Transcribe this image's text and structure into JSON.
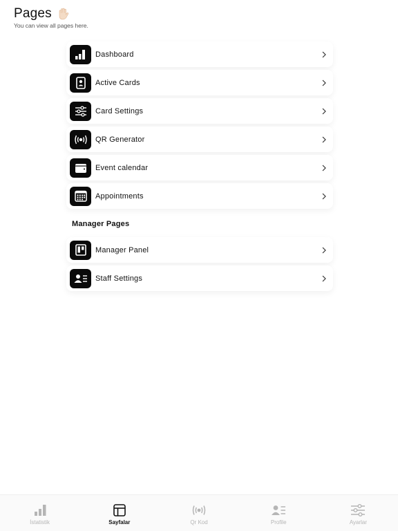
{
  "header": {
    "title": "Pages",
    "subtitle": "You can view all pages here."
  },
  "pages": [
    {
      "label": "Dashboard",
      "icon": "bar-chart-icon"
    },
    {
      "label": "Active Cards",
      "icon": "id-card-icon"
    },
    {
      "label": "Card Settings",
      "icon": "sliders-icon"
    },
    {
      "label": "QR Generator",
      "icon": "broadcast-icon"
    },
    {
      "label": "Event calendar",
      "icon": "wallet-icon"
    },
    {
      "label": "Appointments",
      "icon": "calendar-grid-icon"
    }
  ],
  "manager_section": {
    "title": "Manager Pages",
    "items": [
      {
        "label": "Manager Panel",
        "icon": "panel-icon"
      },
      {
        "label": "Staff Settings",
        "icon": "staff-card-icon"
      }
    ]
  },
  "tabbar": {
    "tabs": [
      {
        "label": "İstatistik",
        "icon": "bar-chart-icon",
        "active": false
      },
      {
        "label": "Sayfalar",
        "icon": "layout-icon",
        "active": true
      },
      {
        "label": "Qr Kod",
        "icon": "broadcast-icon",
        "active": false
      },
      {
        "label": "Profile",
        "icon": "profile-card-icon",
        "active": false
      },
      {
        "label": "Ayarlar",
        "icon": "sliders-icon",
        "active": false
      }
    ]
  },
  "colors": {
    "accent": "#0a0a0a",
    "inactive_tab": "#b5b5b5",
    "background": "#ffffff"
  }
}
